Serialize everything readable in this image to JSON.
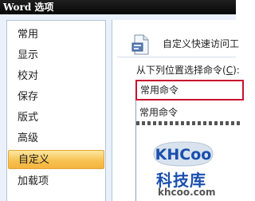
{
  "window": {
    "title": "Word 选项"
  },
  "sidebar": {
    "items": [
      {
        "label": "常用",
        "selected": false
      },
      {
        "label": "显示",
        "selected": false
      },
      {
        "label": "校对",
        "selected": false
      },
      {
        "label": "保存",
        "selected": false
      },
      {
        "label": "版式",
        "selected": false
      },
      {
        "label": "高级",
        "selected": false
      },
      {
        "label": "自定义",
        "selected": true
      },
      {
        "label": "加载项",
        "selected": false
      }
    ]
  },
  "main": {
    "heading": "自定义快速访问工",
    "choose_label_prefix": "从下列位置选择命令(",
    "choose_label_key": "C",
    "choose_label_suffix": "):",
    "combo_value": "常用命令",
    "list_items": [
      "常用命令"
    ]
  },
  "watermark": {
    "logo_text": "KHCoo",
    "text_cn": "科技库",
    "url": "khcoo.com"
  },
  "colors": {
    "titlebar": "#0d0d0d",
    "selected_item": "#f7c354",
    "highlight_border": "#c8102e",
    "dialog_background": "#eaf1fb",
    "watermark_blue": "#1a4fae"
  },
  "icons": {
    "heading_icon": "document-icon"
  }
}
